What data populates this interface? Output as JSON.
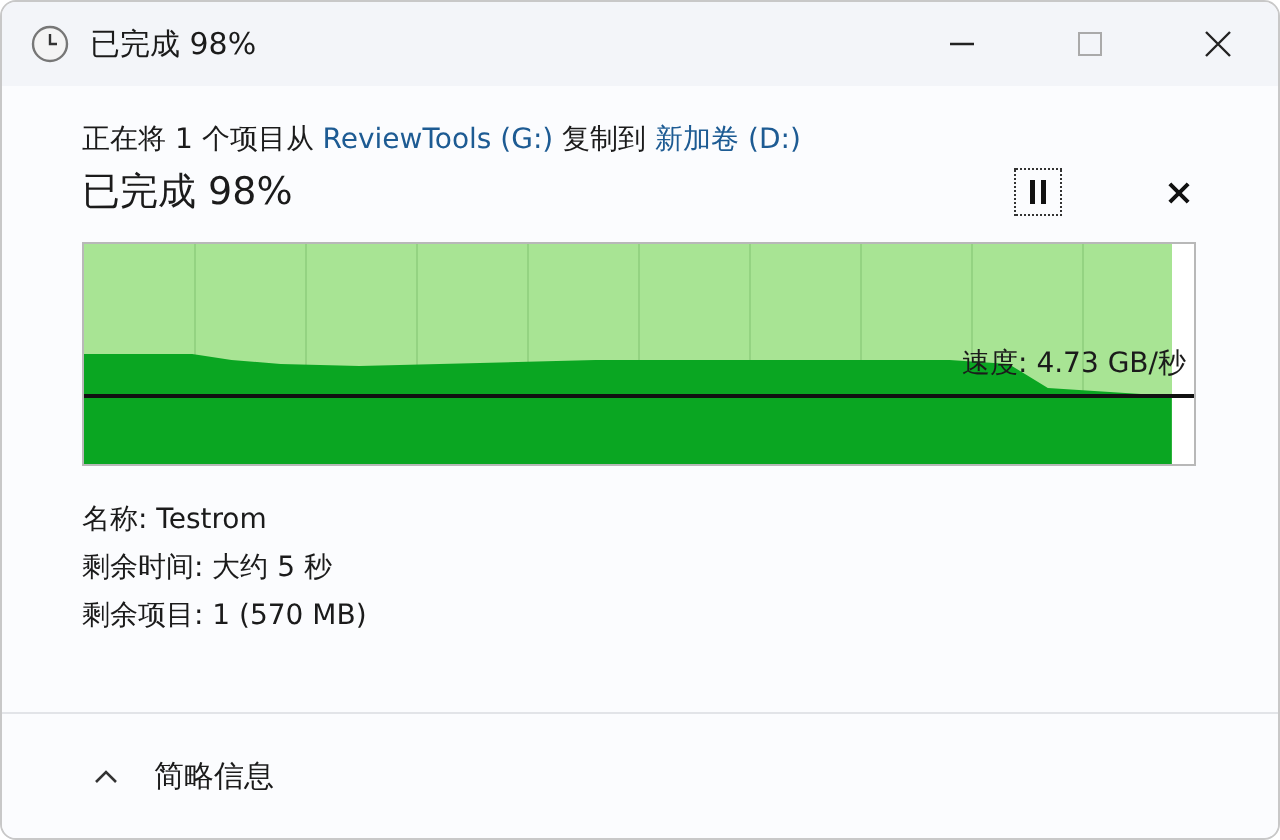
{
  "window": {
    "title": "已完成 98%"
  },
  "transfer": {
    "prefix": "正在将 1 个项目从 ",
    "source": "ReviewTools (G:)",
    "middle": " 复制到 ",
    "destination": "新加卷 (D:)"
  },
  "status": "已完成 98%",
  "progress": {
    "level": 0.98,
    "speed": "速度: 4.73 GB/秒"
  },
  "details": [
    {
      "text": "名称: Testrom"
    },
    {
      "text": "剩余时间: 大约 5 秒"
    },
    {
      "text": "剩余项目: 1 (570 MB)"
    }
  ],
  "toggle": {
    "label": "简略信息",
    "expanded": true
  }
}
